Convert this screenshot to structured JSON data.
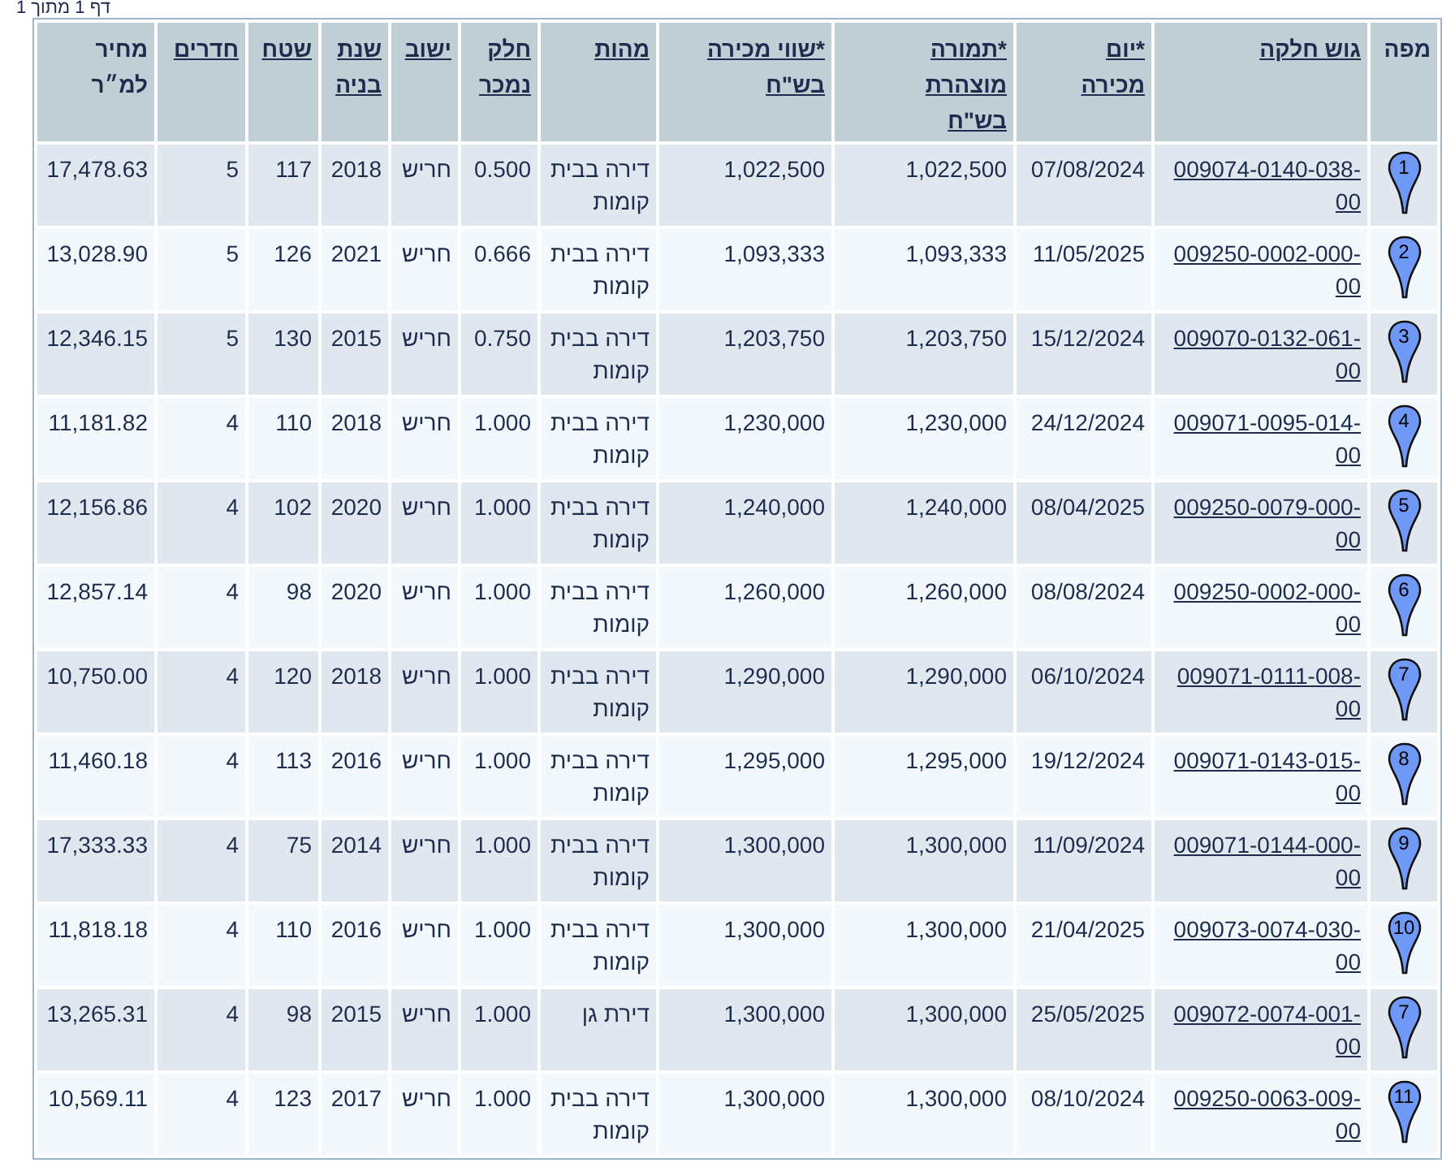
{
  "pager": "דף 1 מתוך 1",
  "table": {
    "columns": [
      {
        "label": "מפה",
        "link": false
      },
      {
        "label": "גוש חלקה",
        "link": true
      },
      {
        "label": "*יום מכירה",
        "link": true
      },
      {
        "label": "*תמורה מוצהרת בש\"ח",
        "link": true
      },
      {
        "label": "*שווי מכירה בש\"ח",
        "link": true
      },
      {
        "label": "מהות",
        "link": true
      },
      {
        "label": "חלק נמכר",
        "link": true
      },
      {
        "label": "ישוב",
        "link": true
      },
      {
        "label": "שנת בניה",
        "link": true
      },
      {
        "label": "שטח",
        "link": true
      },
      {
        "label": "חדרים",
        "link": true
      },
      {
        "label": "מחיר למ״ר",
        "link": false
      }
    ],
    "rows": [
      {
        "pin": "1",
        "parcel": "009074-0140-038-00",
        "date": "07/08/2024",
        "declared": "1,022,500",
        "value": "1,022,500",
        "type": "דירה בבית קומות",
        "share": "0.500",
        "city": "חריש",
        "year": "2018",
        "area": "117",
        "rooms": "5",
        "price_sqm": "17,478.63"
      },
      {
        "pin": "2",
        "parcel": "009250-0002-000-00",
        "date": "11/05/2025",
        "declared": "1,093,333",
        "value": "1,093,333",
        "type": "דירה בבית קומות",
        "share": "0.666",
        "city": "חריש",
        "year": "2021",
        "area": "126",
        "rooms": "5",
        "price_sqm": "13,028.90"
      },
      {
        "pin": "3",
        "parcel": "009070-0132-061-00",
        "date": "15/12/2024",
        "declared": "1,203,750",
        "value": "1,203,750",
        "type": "דירה בבית קומות",
        "share": "0.750",
        "city": "חריש",
        "year": "2015",
        "area": "130",
        "rooms": "5",
        "price_sqm": "12,346.15"
      },
      {
        "pin": "4",
        "parcel": "009071-0095-014-00",
        "date": "24/12/2024",
        "declared": "1,230,000",
        "value": "1,230,000",
        "type": "דירה בבית קומות",
        "share": "1.000",
        "city": "חריש",
        "year": "2018",
        "area": "110",
        "rooms": "4",
        "price_sqm": "11,181.82"
      },
      {
        "pin": "5",
        "parcel": "009250-0079-000-00",
        "date": "08/04/2025",
        "declared": "1,240,000",
        "value": "1,240,000",
        "type": "דירה בבית קומות",
        "share": "1.000",
        "city": "חריש",
        "year": "2020",
        "area": "102",
        "rooms": "4",
        "price_sqm": "12,156.86"
      },
      {
        "pin": "6",
        "parcel": "009250-0002-000-00",
        "date": "08/08/2024",
        "declared": "1,260,000",
        "value": "1,260,000",
        "type": "דירה בבית קומות",
        "share": "1.000",
        "city": "חריש",
        "year": "2020",
        "area": "98",
        "rooms": "4",
        "price_sqm": "12,857.14"
      },
      {
        "pin": "7",
        "parcel": "009071-0111-008-00",
        "date": "06/10/2024",
        "declared": "1,290,000",
        "value": "1,290,000",
        "type": "דירה בבית קומות",
        "share": "1.000",
        "city": "חריש",
        "year": "2018",
        "area": "120",
        "rooms": "4",
        "price_sqm": "10,750.00"
      },
      {
        "pin": "8",
        "parcel": "009071-0143-015-00",
        "date": "19/12/2024",
        "declared": "1,295,000",
        "value": "1,295,000",
        "type": "דירה בבית קומות",
        "share": "1.000",
        "city": "חריש",
        "year": "2016",
        "area": "113",
        "rooms": "4",
        "price_sqm": "11,460.18"
      },
      {
        "pin": "9",
        "parcel": "009071-0144-000-00",
        "date": "11/09/2024",
        "declared": "1,300,000",
        "value": "1,300,000",
        "type": "דירה בבית קומות",
        "share": "1.000",
        "city": "חריש",
        "year": "2014",
        "area": "75",
        "rooms": "4",
        "price_sqm": "17,333.33"
      },
      {
        "pin": "10",
        "parcel": "009073-0074-030-00",
        "date": "21/04/2025",
        "declared": "1,300,000",
        "value": "1,300,000",
        "type": "דירה בבית קומות",
        "share": "1.000",
        "city": "חריש",
        "year": "2016",
        "area": "110",
        "rooms": "4",
        "price_sqm": "11,818.18"
      },
      {
        "pin": "7",
        "parcel": "009072-0074-001-00",
        "date": "25/05/2025",
        "declared": "1,300,000",
        "value": "1,300,000",
        "type": "דירת גן",
        "share": "1.000",
        "city": "חריש",
        "year": "2015",
        "area": "98",
        "rooms": "4",
        "price_sqm": "13,265.31"
      },
      {
        "pin": "11",
        "parcel": "009250-0063-009-00",
        "date": "08/10/2024",
        "declared": "1,300,000",
        "value": "1,300,000",
        "type": "דירה בבית קומות",
        "share": "1.000",
        "city": "חריש",
        "year": "2017",
        "area": "123",
        "rooms": "4",
        "price_sqm": "10,569.11"
      }
    ]
  }
}
